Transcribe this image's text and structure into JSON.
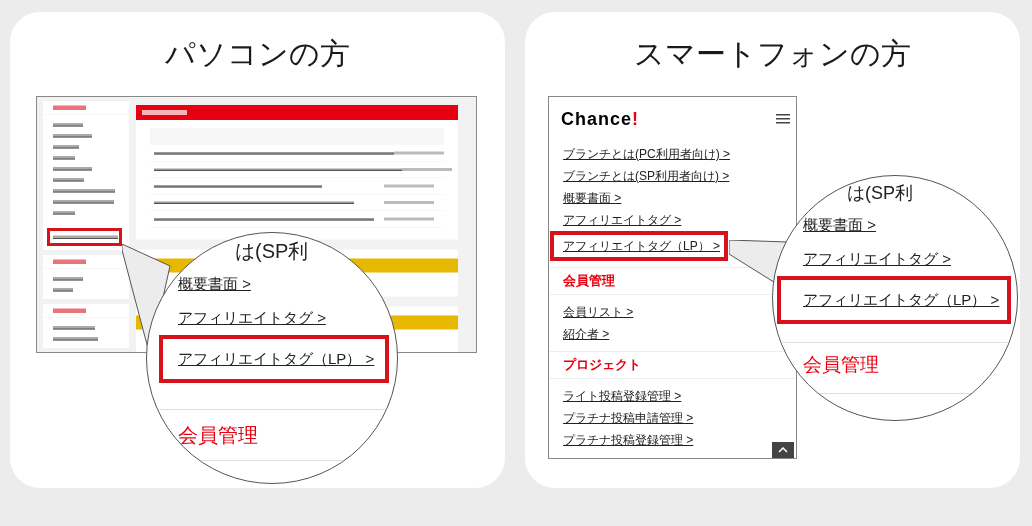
{
  "panels": [
    {
      "kind": "pc",
      "title": "パソコンの方",
      "screenshot": {
        "sidebar": [
          {
            "items": [
              {
                "highlighted": false
              },
              {
                "highlighted": false
              },
              {
                "highlighted": false
              },
              {
                "highlighted": false
              },
              {
                "highlighted": false
              },
              {
                "highlighted": false
              },
              {
                "highlighted": false
              },
              {
                "highlighted": false
              },
              {
                "highlighted": false
              },
              {
                "highlighted": true
              }
            ]
          },
          {
            "items": [
              {
                "highlighted": false
              },
              {
                "highlighted": false
              }
            ]
          },
          {
            "items": [
              {
                "highlighted": false
              },
              {
                "highlighted": false
              }
            ]
          }
        ]
      },
      "magnifier": {
        "partial_text": "は(SP利",
        "items": [
          {
            "label": "概要書面 >",
            "highlighted": false
          },
          {
            "label": "アフィリエイトタグ >",
            "highlighted": false
          },
          {
            "label": "アフィリエイトタグ（LP） >",
            "highlighted": true
          }
        ],
        "heading": "会員管理"
      }
    },
    {
      "kind": "sp",
      "title": "スマートフォンの方",
      "screenshot": {
        "logo": {
          "text": "Chance",
          "mark": "!"
        },
        "sections": [
          {
            "items": [
              {
                "label": "ブランチとは(PC利用者向け) >",
                "highlighted": false
              },
              {
                "label": "ブランチとは(SP利用者向け) >",
                "highlighted": false
              },
              {
                "label": "概要書面 >",
                "highlighted": false
              },
              {
                "label": "アフィリエイトタグ >",
                "highlighted": false
              },
              {
                "label": "アフィリエイトタグ（LP） >",
                "highlighted": true
              }
            ]
          },
          {
            "heading": "会員管理",
            "items": [
              {
                "label": "会員リスト >",
                "highlighted": false
              },
              {
                "label": "紹介者 >",
                "highlighted": false
              }
            ]
          },
          {
            "heading": "プロジェクト",
            "items": [
              {
                "label": "ライト投稿登録管理 >",
                "highlighted": false
              },
              {
                "label": "プラチナ投稿申請管理 >",
                "highlighted": false
              },
              {
                "label": "プラチナ投稿登録管理 >",
                "highlighted": false
              }
            ]
          }
        ]
      },
      "magnifier": {
        "partial_text": "は(SP利",
        "items": [
          {
            "label": "概要書面 >",
            "highlighted": false
          },
          {
            "label": "アフィリエイトタグ >",
            "highlighted": false
          },
          {
            "label": "アフィリエイトタグ（LP） >",
            "highlighted": true
          }
        ],
        "heading": "会員管理"
      }
    }
  ]
}
